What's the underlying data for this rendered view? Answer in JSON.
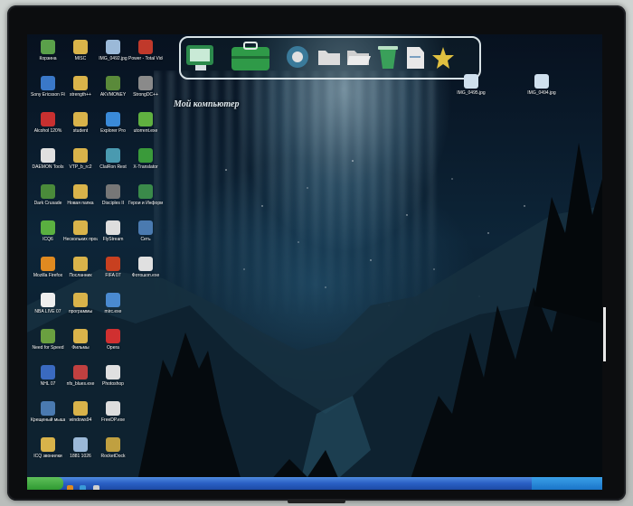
{
  "desktop": {
    "icons": [
      {
        "label": "Корзина",
        "color": "#5aa04a"
      },
      {
        "label": "MISC",
        "color": "#d9b34a"
      },
      {
        "label": "IMG_0492.jpg",
        "color": "#9bb9d8"
      },
      {
        "label": "Power - Total Video",
        "color": "#c0392b"
      },
      {
        "label": "Sony Ericsson File Manager",
        "color": "#3a78c8"
      },
      {
        "label": "strength++",
        "color": "#d9b34a"
      },
      {
        "label": "AKVMONEY",
        "color": "#5a8a3a"
      },
      {
        "label": "StrongDC++",
        "color": "#8a8a8a"
      },
      {
        "label": "Alcohol 120%",
        "color": "#c83030"
      },
      {
        "label": "student",
        "color": "#d9b34a"
      },
      {
        "label": "Explorer Pro",
        "color": "#3a8ad8"
      },
      {
        "label": "utorrent.exe",
        "color": "#60b040"
      },
      {
        "label": "DAEMON Tools",
        "color": "#e0e0e0"
      },
      {
        "label": "VTP_b_rc2",
        "color": "#d9b34a"
      },
      {
        "label": "ClaiRon Rest",
        "color": "#4a9ab0"
      },
      {
        "label": "X-Translator",
        "color": "#3a9a3a"
      },
      {
        "label": "Dark Crusade",
        "color": "#4a8a3a"
      },
      {
        "label": "Новая папка",
        "color": "#d9b34a"
      },
      {
        "label": "Disciples II",
        "color": "#777777"
      },
      {
        "label": "Герои и Информ",
        "color": "#3a8a4a"
      },
      {
        "label": "ICQ6",
        "color": "#5ab040"
      },
      {
        "label": "Нескольких процессов",
        "color": "#d9b34a"
      },
      {
        "label": "FlyStream",
        "color": "#dddddd"
      },
      {
        "label": "Сеть",
        "color": "#4a7ab0"
      },
      {
        "label": "Mozilla Firefox",
        "color": "#e08a20"
      },
      {
        "label": "Посланник",
        "color": "#d9b34a"
      },
      {
        "label": "FIFA 07",
        "color": "#c84020"
      },
      {
        "label": "Фотошоп.exe",
        "color": "#e0e0e0"
      },
      {
        "label": "NBA LIVE 07",
        "color": "#eeeeee"
      },
      {
        "label": "программы",
        "color": "#d9b34a"
      },
      {
        "label": "mirc.exe",
        "color": "#4a8ad0"
      },
      {
        "label": "",
        "color": ""
      },
      {
        "label": "Need for Speed",
        "color": "#6aa040"
      },
      {
        "label": "Фильмы",
        "color": "#d9b34a"
      },
      {
        "label": "Opera",
        "color": "#d03030"
      },
      {
        "label": "",
        "color": ""
      },
      {
        "label": "NHL 07",
        "color": "#3a6ac0"
      },
      {
        "label": "nfs_blues.exe",
        "color": "#c04040"
      },
      {
        "label": "Photoshop",
        "color": "#e0e0e0"
      },
      {
        "label": "",
        "color": ""
      },
      {
        "label": "Крещеный мышь",
        "color": "#4a7ab0"
      },
      {
        "label": "windows94",
        "color": "#d9b34a"
      },
      {
        "label": "FreeDP.exe",
        "color": "#dddddd"
      },
      {
        "label": "",
        "color": ""
      },
      {
        "label": "ICQ звонилки",
        "color": "#d9b34a"
      },
      {
        "label": "1881 1026",
        "color": "#9bb9d8"
      },
      {
        "label": "RocketDock",
        "color": "#c0a040"
      },
      {
        "label": "",
        "color": ""
      }
    ],
    "right_icons": [
      {
        "label": "IMG_0495.jpg"
      },
      {
        "label": "IMG_0494.jpg"
      }
    ],
    "my_computer_label": "Мой компьютер"
  },
  "dock": {
    "items": [
      {
        "name": "computer",
        "color": "#3aa05a"
      },
      {
        "name": "briefcase",
        "color": "#2f9a48"
      },
      {
        "name": "network",
        "color": "#e0e0e0"
      },
      {
        "name": "folder",
        "color": "#dcdcdc"
      },
      {
        "name": "folder-open",
        "color": "#dcdcdc"
      },
      {
        "name": "recycle",
        "color": "#3aa05a"
      },
      {
        "name": "document",
        "color": "#dcdcdc"
      },
      {
        "name": "star",
        "color": "#e0c040"
      }
    ]
  },
  "taskbar": {
    "start_label": "",
    "clock": ""
  }
}
